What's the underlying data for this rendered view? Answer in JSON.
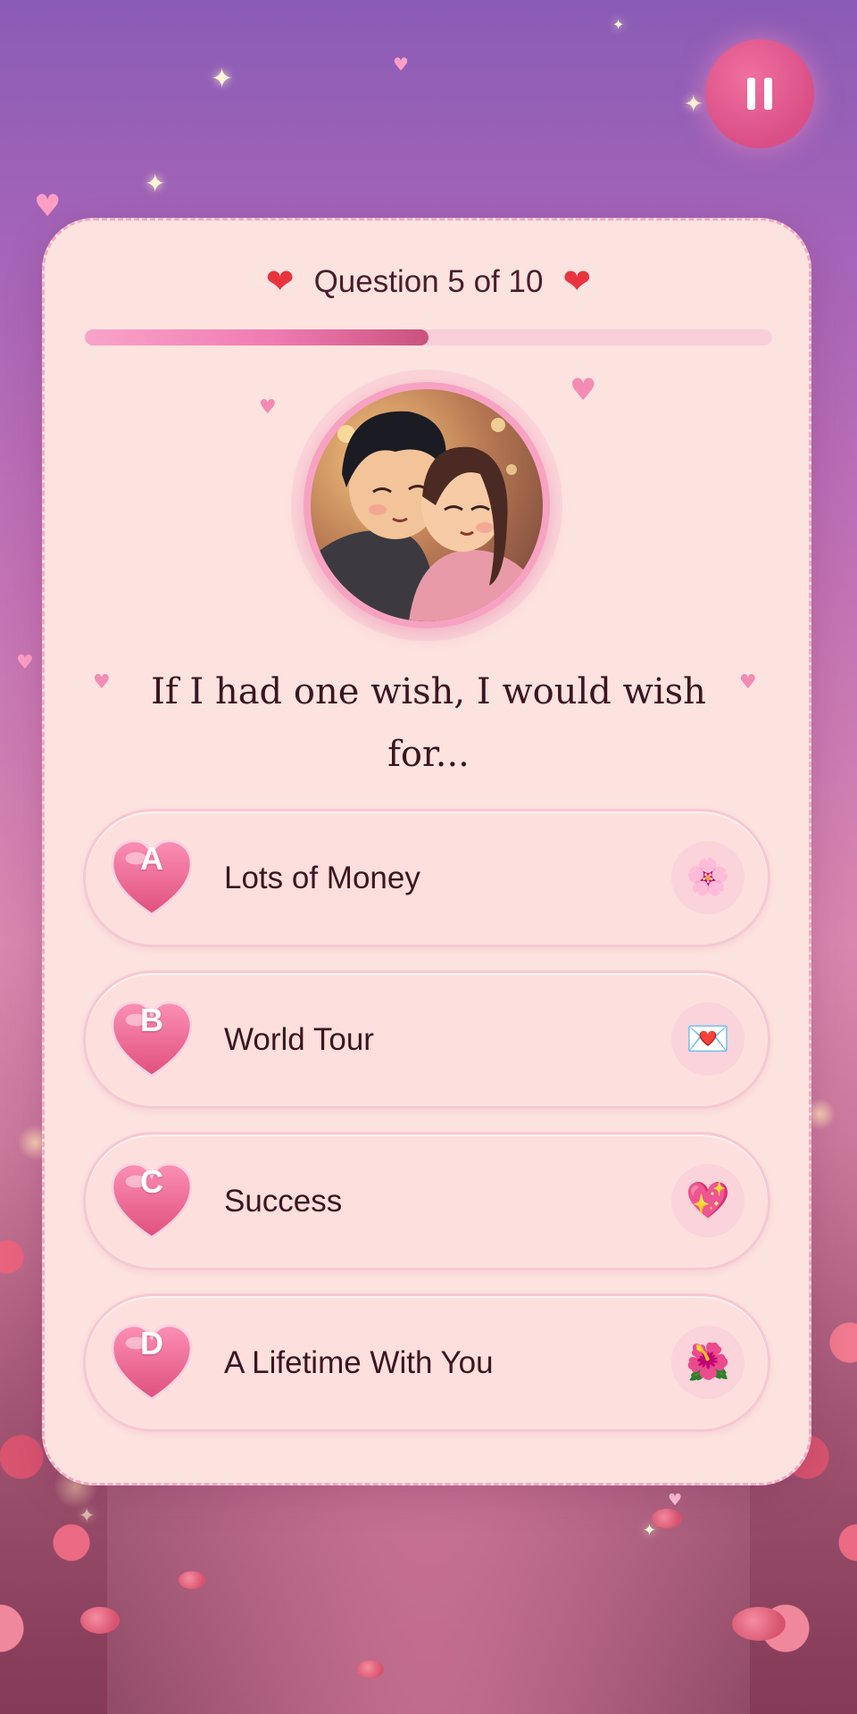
{
  "header": {
    "question_label": "Question 5 of 10",
    "left_heart": "❤",
    "right_heart": "❤"
  },
  "progress": {
    "current": 5,
    "total": 10,
    "fraction": 0.5
  },
  "question": {
    "text": "If I had one wish, I would wish for..."
  },
  "options": [
    {
      "letter": "A",
      "label": "Lots of Money",
      "badge_icon": "flower-icon",
      "badge": "🌸"
    },
    {
      "letter": "B",
      "label": "World Tour",
      "badge_icon": "love-letter-icon",
      "badge": "💌"
    },
    {
      "letter": "C",
      "label": "Success",
      "badge_icon": "sparkling-heart-icon",
      "badge": "💖"
    },
    {
      "letter": "D",
      "label": "A Lifetime With You",
      "badge_icon": "hibiscus-icon",
      "badge": "🌺"
    }
  ],
  "pause": {
    "icon": "pause-icon"
  },
  "colors": {
    "accent_pink": "#f07bb1",
    "card_bg": "#fde3e0",
    "heart_red": "#e8343e",
    "text_dark": "#3d141f"
  }
}
